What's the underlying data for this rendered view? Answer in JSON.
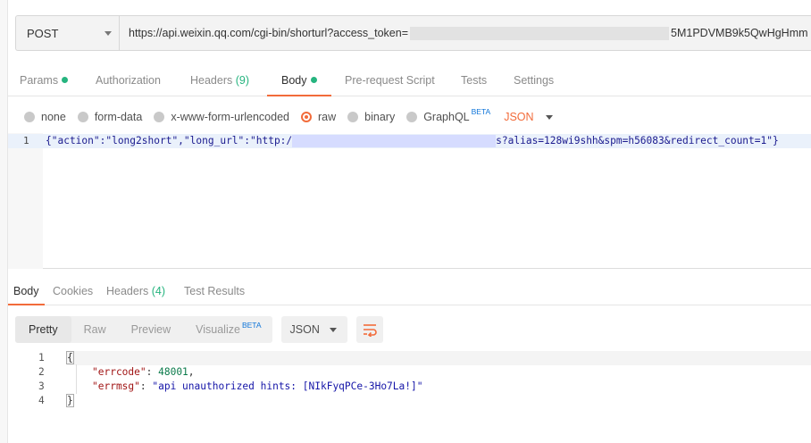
{
  "request": {
    "method": "POST",
    "url_prefix": "https://api.weixin.qq.com/cgi-bin/shorturl?access_token=",
    "url_suffix": "5M1PDVMB9k5QwHgHmm"
  },
  "request_tabs": {
    "params": "Params",
    "authorization": "Authorization",
    "headers": "Headers",
    "headers_count": "(9)",
    "body": "Body",
    "pre_request": "Pre-request Script",
    "tests": "Tests",
    "settings": "Settings"
  },
  "body_types": {
    "none": "none",
    "form_data": "form-data",
    "urlencoded": "x-www-form-urlencoded",
    "raw": "raw",
    "binary": "binary",
    "graphql": "GraphQL",
    "beta": "BETA",
    "format": "JSON"
  },
  "request_body": {
    "line_number": "1",
    "code_start": "{\"action\":\"long2short\",\"long_url\":\"http:/",
    "code_end": "s?alias=128wi9shh&spm=h56083&redirect_count=1\"}"
  },
  "response_tabs": {
    "body": "Body",
    "cookies": "Cookies",
    "headers": "Headers",
    "headers_count": "(4)",
    "test_results": "Test Results"
  },
  "response_toolbar": {
    "pretty": "Pretty",
    "raw": "Raw",
    "preview": "Preview",
    "visualize": "Visualize",
    "beta": "BETA",
    "format": "JSON",
    "wrap_icon": "wrap-lines-icon"
  },
  "response_body": {
    "lines": [
      {
        "n": "1",
        "open": "{"
      },
      {
        "n": "2",
        "key": "\"errcode\"",
        "sep": ": ",
        "value": "48001",
        "end": ","
      },
      {
        "n": "3",
        "key": "\"errmsg\"",
        "sep": ": ",
        "value": "\"api unauthorized hints: [NIkFyqPCe-3Ho7La!]\"",
        "end": ""
      },
      {
        "n": "4",
        "close": "}"
      }
    ]
  },
  "colors": {
    "accent": "#f26b3a",
    "count_green": "#26b47f",
    "beta_blue": "#0f75d9"
  }
}
